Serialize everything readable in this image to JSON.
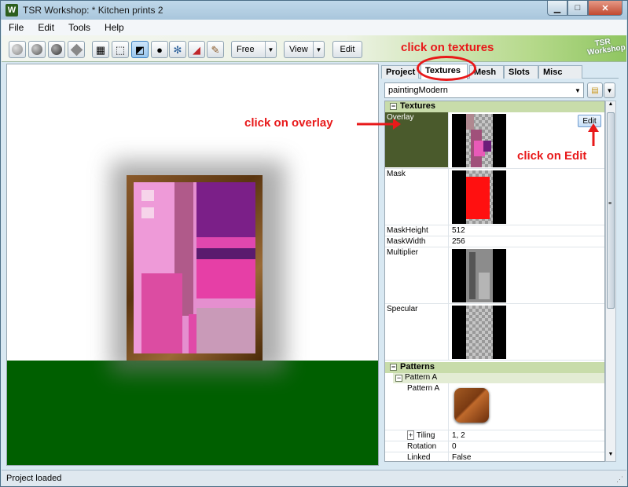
{
  "window": {
    "title": "TSR Workshop: * Kitchen prints 2",
    "logo": "W",
    "minimize": "▁",
    "maximize": "□",
    "close": "✕"
  },
  "menu": [
    "File",
    "Edit",
    "Tools",
    "Help"
  ],
  "toolbar": {
    "mode_select": "Free",
    "view_select": "View",
    "edit_label": "Edit",
    "brand": "TSR\nWorkshop"
  },
  "panel": {
    "tabs": [
      "Project",
      "Textures",
      "Mesh",
      "Slots",
      "Misc"
    ],
    "active_tab": "Textures",
    "material_select": "paintingModern",
    "textures_section": {
      "title": "Textures",
      "rows": {
        "overlay": "Overlay",
        "mask": "Mask",
        "mask_height_label": "MaskHeight",
        "mask_height_value": "512",
        "mask_width_label": "MaskWidth",
        "mask_width_value": "256",
        "multiplier": "Multiplier",
        "specular": "Specular"
      },
      "edit_button": "Edit"
    },
    "patterns_section": {
      "title": "Patterns",
      "pattern_a_group": "Pattern A",
      "pattern_a_label": "Pattern A",
      "tiling_label": "Tiling",
      "tiling_value": "1, 2",
      "rotation_label": "Rotation",
      "rotation_value": "0",
      "linked_label": "Linked",
      "linked_value": "False"
    }
  },
  "status": {
    "text": "Project loaded"
  },
  "annotations": {
    "textures": "click on textures",
    "overlay": "click on overlay",
    "edit": "click on Edit"
  },
  "colors": {
    "annotation": "#e8191a",
    "floor": "#005f00",
    "overlay_swatch": "#4a5a2c",
    "section_header": "#c8dcaa"
  }
}
